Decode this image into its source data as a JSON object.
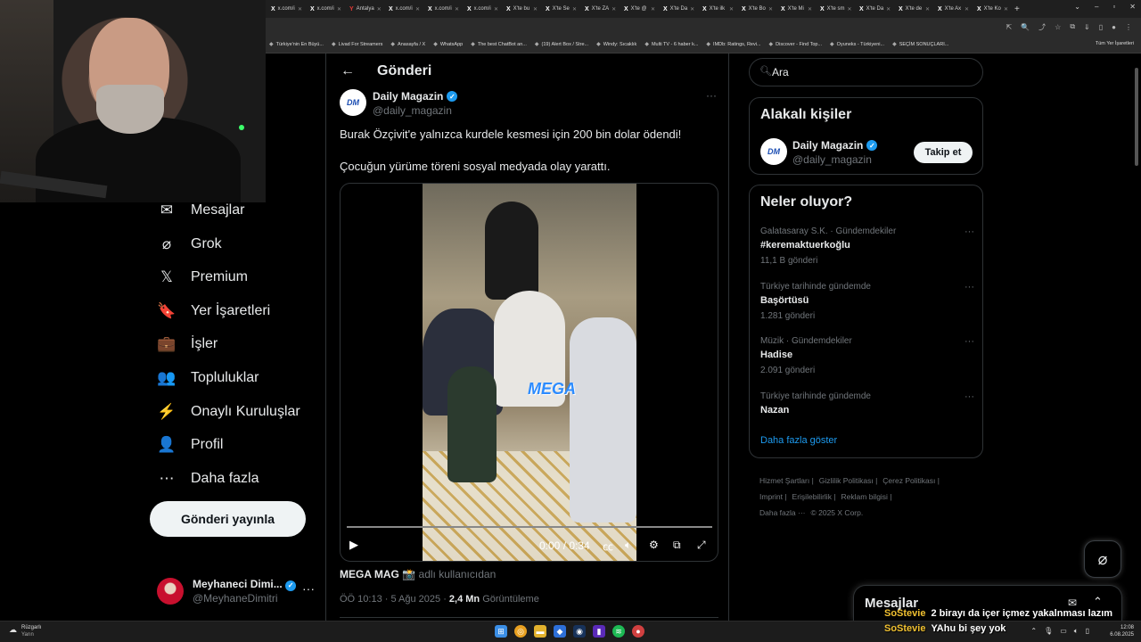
{
  "browser": {
    "tabs": [
      {
        "icon": "X",
        "label": "x.com/i"
      },
      {
        "icon": "X",
        "label": "x.com/i"
      },
      {
        "icon": "Y",
        "label": "Antalya"
      },
      {
        "icon": "X",
        "label": "x.com/i"
      },
      {
        "icon": "X",
        "label": "x.com/i"
      },
      {
        "icon": "X",
        "label": "x.com/i"
      },
      {
        "icon": "X",
        "label": "X'te bu"
      },
      {
        "icon": "X",
        "label": "X'te Se"
      },
      {
        "icon": "X",
        "label": "X'te ZA"
      },
      {
        "icon": "X",
        "label": "X'te @"
      },
      {
        "icon": "X",
        "label": "X'te Da"
      },
      {
        "icon": "X",
        "label": "X'te ilk"
      },
      {
        "icon": "X",
        "label": "X'te Bo"
      },
      {
        "icon": "X",
        "label": "X'te Mi"
      },
      {
        "icon": "X",
        "label": "X'te sm"
      },
      {
        "icon": "X",
        "label": "X'te Da"
      },
      {
        "icon": "X",
        "label": "X'te de"
      },
      {
        "icon": "X",
        "label": "X'te Ax"
      },
      {
        "icon": "X",
        "label": "X'te Ko"
      }
    ],
    "bookmarks": [
      "Türkiye'nin En Büyü...",
      "Livad For Streamers",
      "Anasayfa / X",
      "WhatsApp",
      "The best ChatBot an...",
      "(19) Alert Box / Stre...",
      "Windy: Sıcaklık",
      "Multi TV - 6 haber k...",
      "IMDb: Ratings, Revi...",
      "Discover - Find Top...",
      "Oyuneks - Türkiyeni...",
      "SEÇİM SONUÇLARI..."
    ],
    "bookmarks_all": "Tüm Yer İşaretleri"
  },
  "nav": {
    "items": [
      {
        "icon": "✉",
        "label": "Mesajlar"
      },
      {
        "icon": "⌀",
        "label": "Grok"
      },
      {
        "icon": "𝕏",
        "label": "Premium"
      },
      {
        "icon": "🔖",
        "label": "Yer İşaretleri"
      },
      {
        "icon": "💼",
        "label": "İşler"
      },
      {
        "icon": "👥",
        "label": "Topluluklar"
      },
      {
        "icon": "⚡",
        "label": "Onaylı Kuruluşlar"
      },
      {
        "icon": "👤",
        "label": "Profil"
      },
      {
        "icon": "⋯",
        "label": "Daha fazla"
      }
    ],
    "post_button": "Gönderi yayınla",
    "account": {
      "name": "Meyhaneci Dimi...",
      "handle": "@MeyhaneDimitri"
    }
  },
  "post": {
    "header_title": "Gönderi",
    "author_name": "Daily Magazin",
    "author_handle": "@daily_magazin",
    "avatar_text": "DM",
    "text_line1": "Burak Özçivit'e yalnızca kurdele kesmesi için 200 bin dolar ödendi!",
    "text_line2": "Çocuğun yürüme töreni sosyal medyada olay yarattı.",
    "video": {
      "time": "0:00 / 0:34",
      "watermark": "MEGA",
      "progress": 0.0
    },
    "source_user": "MEGA MAG 📸",
    "source_suffix": "adlı kullanıcıdan",
    "timestamp": "ÖÖ 10:13 · 5 Ağu 2025 ·",
    "views": "2,4 Mn",
    "views_label": "Görüntüleme"
  },
  "sidebar": {
    "search_placeholder": "Ara",
    "related_title": "Alakalı kişiler",
    "related": {
      "name": "Daily Magazin",
      "handle": "@daily_magazin",
      "follow": "Takip et"
    },
    "trends_title": "Neler oluyor?",
    "trends": [
      {
        "context": "Galatasaray S.K. · Gündemdekiler",
        "name": "#keremaktuerkoğlu",
        "count": "11,1 B gönderi"
      },
      {
        "context": "Türkiye tarihinde gündemde",
        "name": "Başörtüsü",
        "count": "1.281 gönderi"
      },
      {
        "context": "Müzik · Gündemdekiler",
        "name": "Hadise",
        "count": "2.091 gönderi"
      },
      {
        "context": "Türkiye tarihinde gündemde",
        "name": "Nazan",
        "count": ""
      }
    ],
    "show_more": "Daha fazla göster",
    "footer": [
      "Hizmet Şartları |",
      "Gizlilik Politikası |",
      "Çerez Politikası |",
      "Imprint |",
      "Erişilebilirlik |",
      "Reklam bilgisi |",
      "Daha fazla ···",
      "© 2025 X Corp."
    ]
  },
  "messages_drawer": {
    "title": "Mesajlar"
  },
  "chat": [
    {
      "user": "SoStevie",
      "text": "2 birayı da içer içmez yakalnması lazım"
    },
    {
      "user": "SoStevie",
      "text": "YAhu bi şey yok"
    }
  ],
  "taskbar": {
    "weather_title": "Rüzgarlı",
    "weather_sub": "Yarın",
    "time": "12:08",
    "date": "6.08.2025"
  },
  "colors": {
    "accent": "#1d9bf0",
    "border": "#2f3336",
    "muted": "#71767b",
    "chat_user": "#f0c030"
  }
}
